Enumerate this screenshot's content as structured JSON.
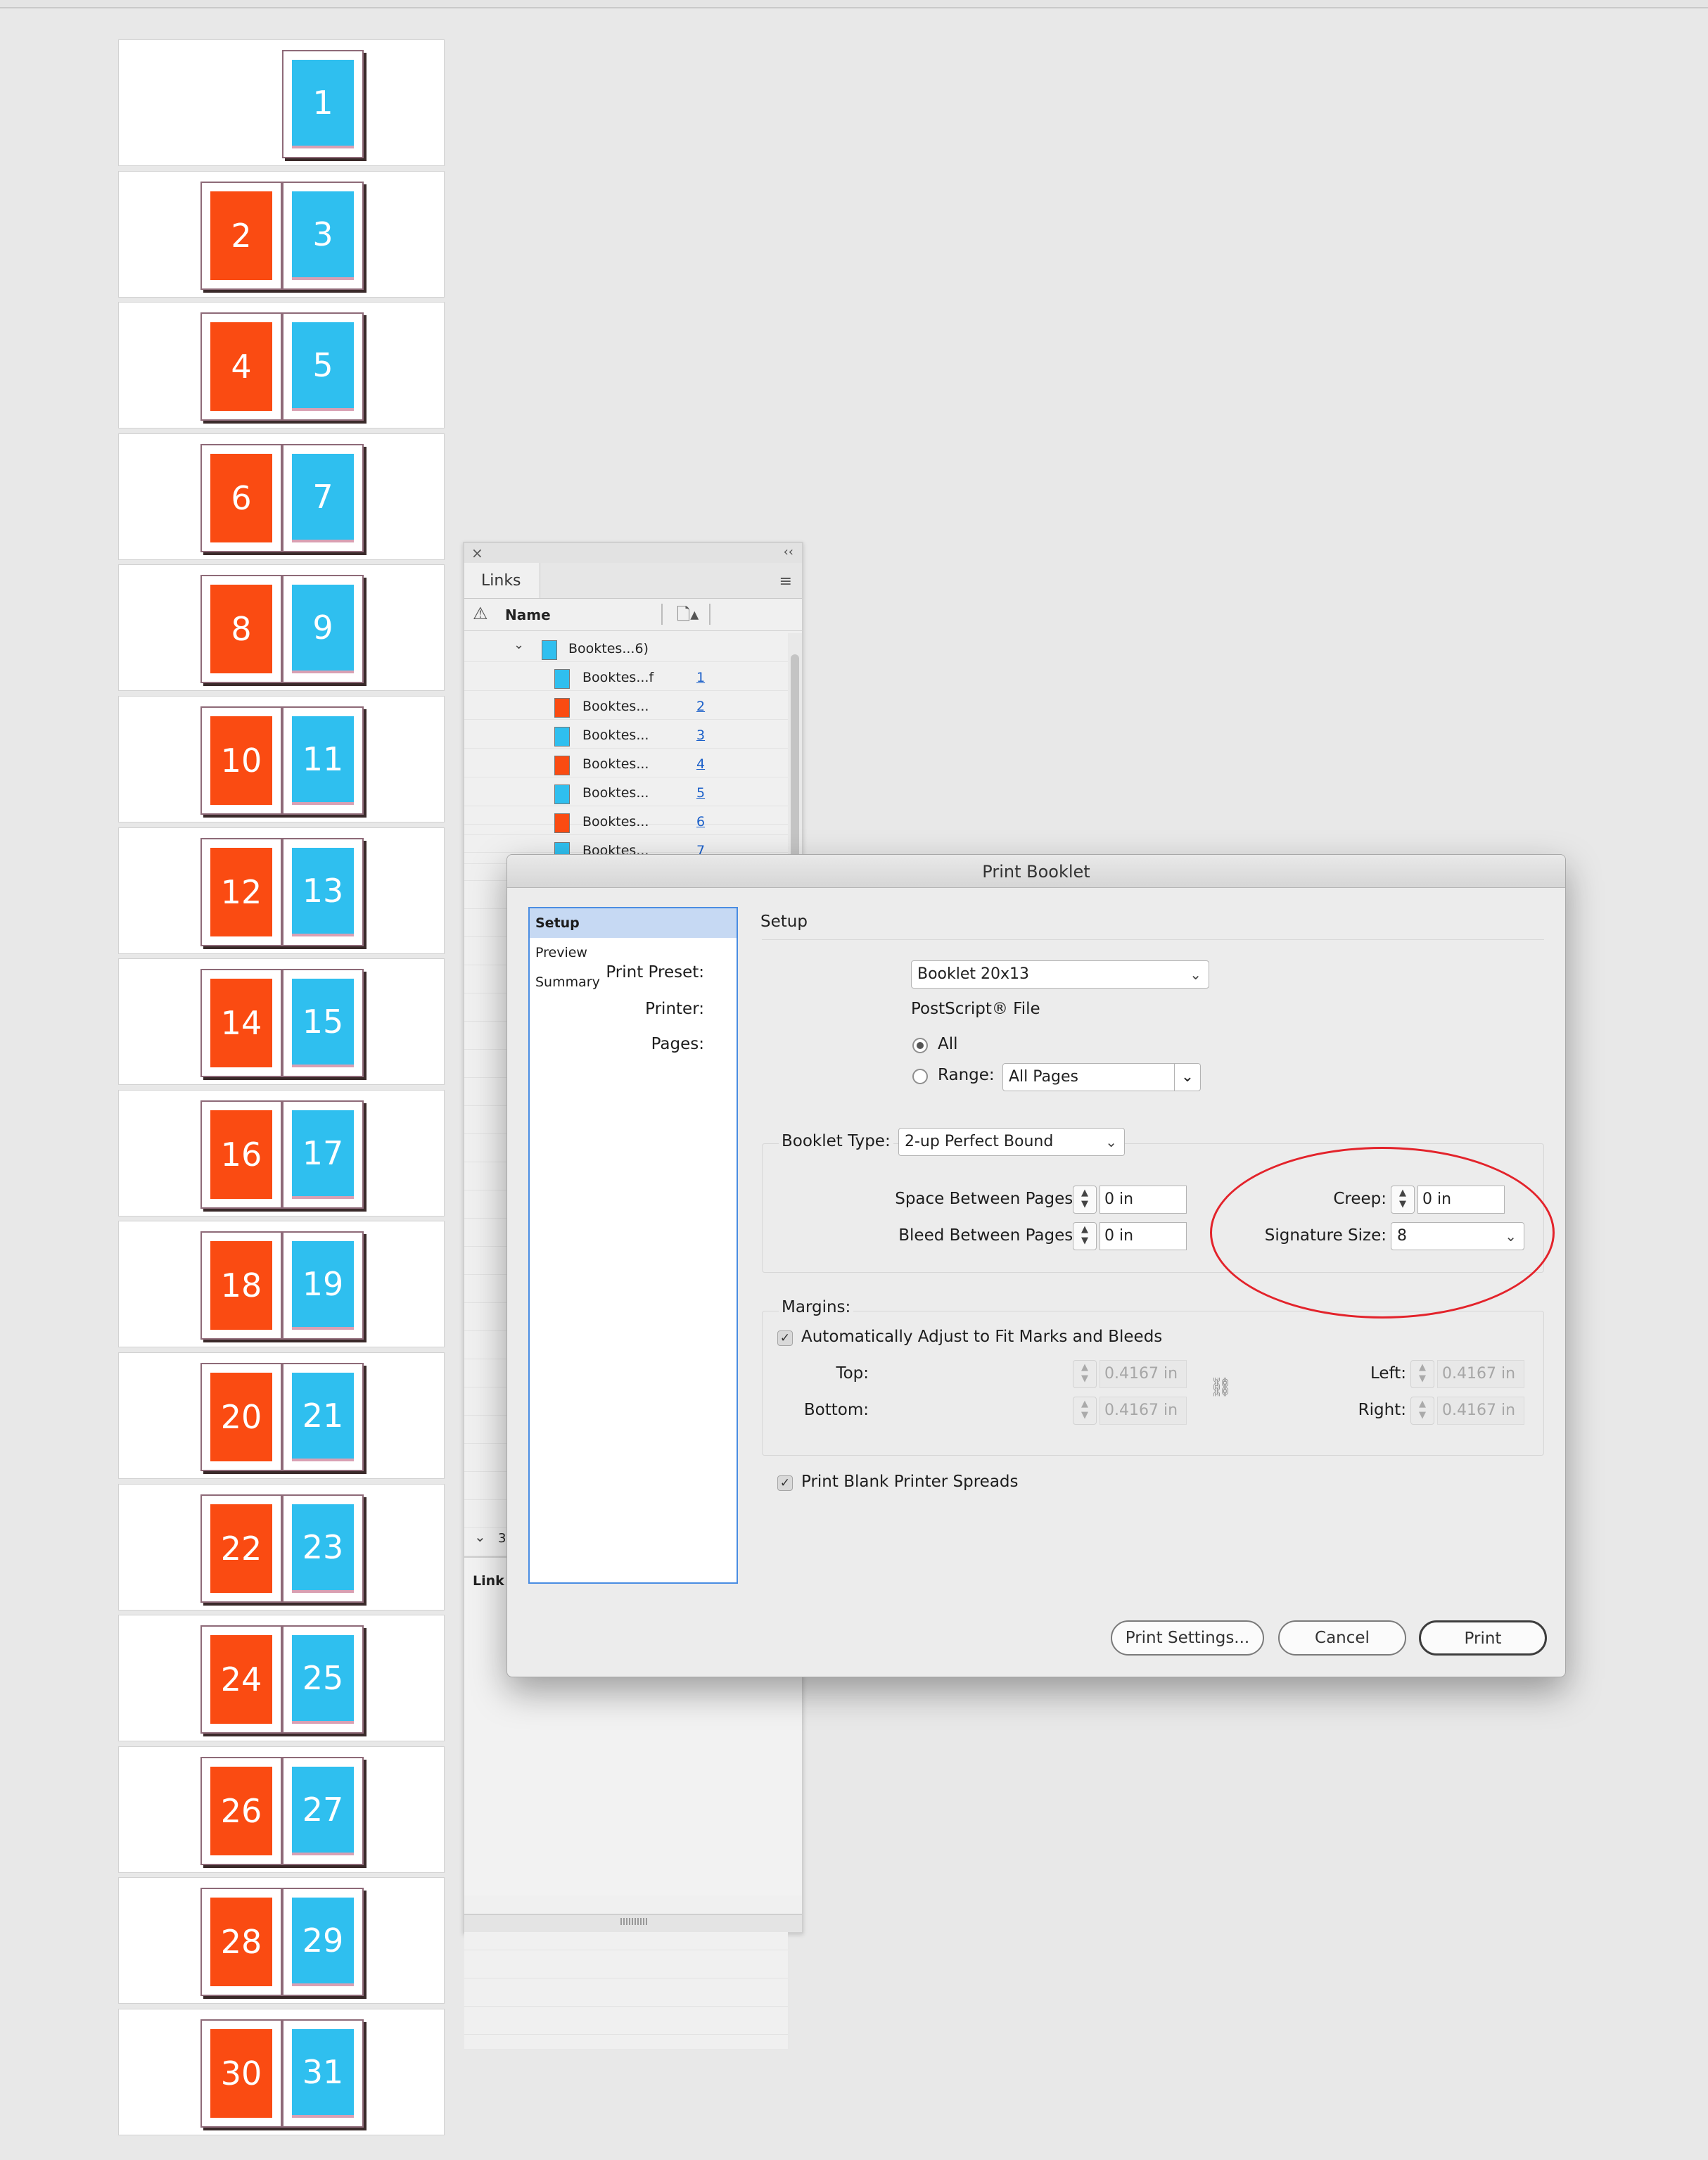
{
  "pages_panel": {
    "spreads": [
      {
        "left": null,
        "right": "1"
      },
      {
        "left": "2",
        "right": "3"
      },
      {
        "left": "4",
        "right": "5"
      },
      {
        "left": "6",
        "right": "7"
      },
      {
        "left": "8",
        "right": "9"
      },
      {
        "left": "10",
        "right": "11"
      },
      {
        "left": "12",
        "right": "13"
      },
      {
        "left": "14",
        "right": "15"
      },
      {
        "left": "16",
        "right": "17"
      },
      {
        "left": "18",
        "right": "19"
      },
      {
        "left": "20",
        "right": "21"
      },
      {
        "left": "22",
        "right": "23"
      },
      {
        "left": "24",
        "right": "25"
      },
      {
        "left": "26",
        "right": "27"
      },
      {
        "left": "28",
        "right": "29"
      },
      {
        "left": "30",
        "right": "31"
      }
    ],
    "colors": {
      "left_page": "#fa4b12",
      "right_page": "#2fbfef"
    }
  },
  "links_panel": {
    "tab": "Links",
    "column_name": "Name",
    "parent": {
      "label": "Booktes...6)"
    },
    "rows": [
      {
        "label": "Booktes...f",
        "page": "1",
        "color": "blue"
      },
      {
        "label": "Booktes...",
        "page": "2",
        "color": "orange"
      },
      {
        "label": "Booktes...",
        "page": "3",
        "color": "blue"
      },
      {
        "label": "Booktes...",
        "page": "4",
        "color": "orange"
      },
      {
        "label": "Booktes...",
        "page": "5",
        "color": "blue"
      },
      {
        "label": "Booktes...",
        "page": "6",
        "color": "orange"
      },
      {
        "label": "Booktes...",
        "page": "7",
        "color": "blue"
      }
    ],
    "info_count": "3",
    "info_link_label": "Link"
  },
  "dialog": {
    "title": "Print Booklet",
    "nav": [
      "Setup",
      "Preview",
      "Summary"
    ],
    "section_title": "Setup",
    "print_preset_label": "Print Preset:",
    "print_preset_value": "Booklet 20x13",
    "printer_label": "Printer:",
    "printer_value": "PostScript® File",
    "pages_label": "Pages:",
    "pages_all": "All",
    "pages_range_label": "Range:",
    "pages_range_value": "All Pages",
    "booklet_type_label": "Booklet Type:",
    "booklet_type_value": "2-up Perfect Bound",
    "space_between_label": "Space Between Pages:",
    "space_between_value": "0 in",
    "bleed_between_label": "Bleed Between Pages:",
    "bleed_between_value": "0 in",
    "creep_label": "Creep:",
    "creep_value": "0 in",
    "signature_label": "Signature Size:",
    "signature_value": "8",
    "margins_label": "Margins:",
    "auto_adjust_label": "Automatically Adjust to Fit Marks and Bleeds",
    "top_label": "Top:",
    "top_value": "0.4167 in",
    "bottom_label": "Bottom:",
    "bottom_value": "0.4167 in",
    "left_label": "Left:",
    "left_value": "0.4167 in",
    "right_label": "Right:",
    "right_value": "0.4167 in",
    "print_blank_label": "Print Blank Printer Spreads",
    "buttons": {
      "print_settings": "Print Settings...",
      "cancel": "Cancel",
      "print": "Print"
    }
  },
  "annotation_color": "#e3232b"
}
